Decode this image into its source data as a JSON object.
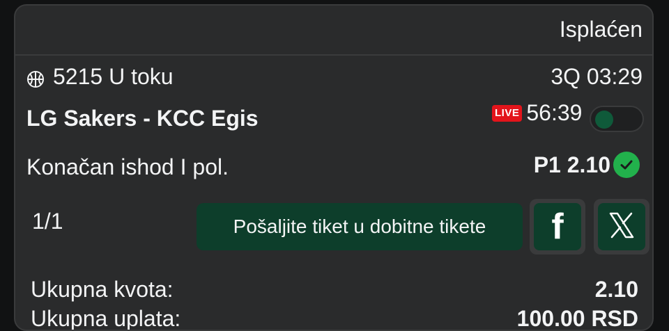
{
  "ticket": {
    "status": "Isplaćen",
    "event_code_status": "5215 U toku",
    "period_time": "3Q 03:29",
    "match": "LG Sakers - KCC Egis",
    "live_label": "LIVE",
    "live_score": "56:39",
    "market": "Konačan ishod I pol.",
    "pick": "P1 2.10",
    "count": "1/1",
    "send_button": "Pošaljite tiket u dobitne tikete",
    "facebook_glyph": "f",
    "total_odds_label": "Ukupna kvota:",
    "total_odds_value": "2.10",
    "next_label_partial": "Ukupna uplata:",
    "next_value_partial": "100.00 RSD"
  },
  "colors": {
    "background": "#111213",
    "card": "#2a2b2c",
    "accent_green": "#0d3e2b",
    "live_red": "#e3141b",
    "check_green": "#22b14c"
  },
  "icons": {
    "sport": "basketball-icon",
    "win": "check-icon",
    "share_facebook": "facebook-icon",
    "share_x": "x-icon"
  }
}
